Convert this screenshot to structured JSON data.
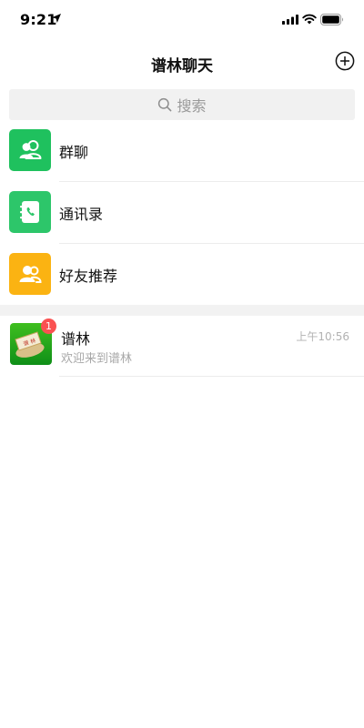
{
  "status_bar": {
    "time": "9:21",
    "icons": [
      "location-arrow-icon",
      "cellular-signal-icon",
      "wifi-icon",
      "battery-icon"
    ]
  },
  "header": {
    "title": "谱林聊天",
    "action_icon": "plus-circle-icon"
  },
  "search": {
    "placeholder": "搜索",
    "icon": "search-icon"
  },
  "menu": {
    "items": [
      {
        "label": "群聊",
        "icon": "group-chat-icon",
        "color": "#1fc15e"
      },
      {
        "label": "通讯录",
        "icon": "contacts-book-icon",
        "color": "#2dc66a"
      },
      {
        "label": "好友推荐",
        "icon": "friend-recommend-icon",
        "color": "#fbb312"
      }
    ]
  },
  "chats": [
    {
      "name": "谱林",
      "preview": "欢迎来到谱林",
      "time": "上午10:56",
      "unread": "1",
      "avatar_icon": "pulin-logo-avatar"
    }
  ],
  "colors": {
    "badge": "#fa5151",
    "section_gap": "#f2f2f2",
    "search_bg": "#f1f1f1"
  }
}
